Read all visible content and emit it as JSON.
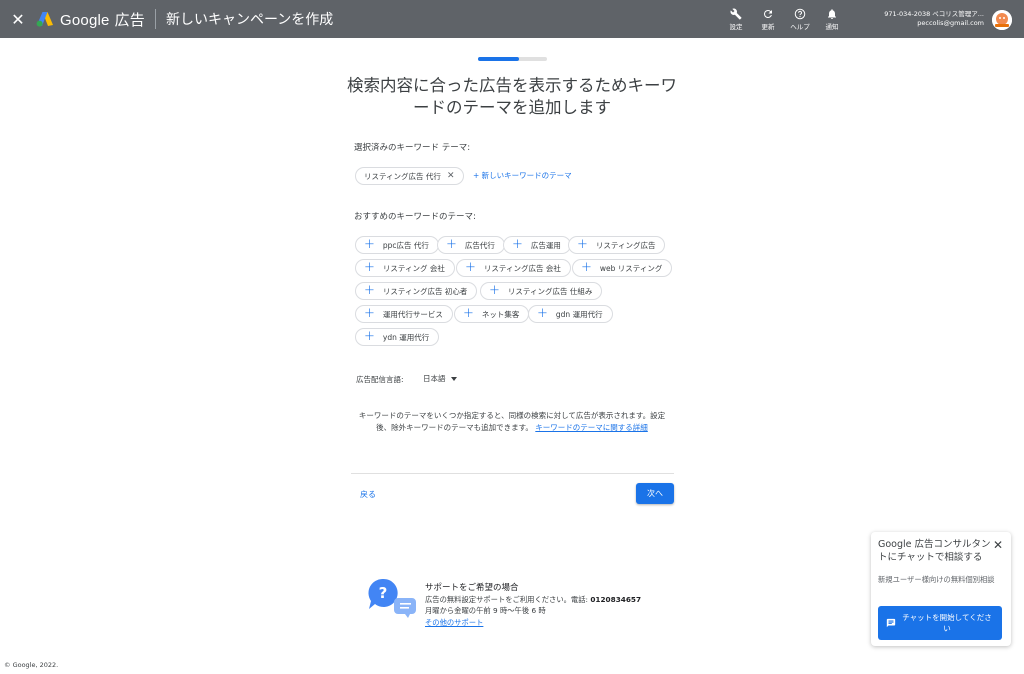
{
  "topbar": {
    "close_icon": "close-icon",
    "brand_google": "Google",
    "brand_ads": "広告",
    "page_title": "新しいキャンペーンを作成",
    "actions": [
      {
        "icon": "wrench-icon",
        "label": "設定"
      },
      {
        "icon": "refresh-icon",
        "label": "更新"
      },
      {
        "icon": "help-icon",
        "label": "ヘルプ"
      },
      {
        "icon": "bell-icon",
        "label": "通知"
      }
    ],
    "account_line1": "971-034-2038 ペコリス管理ア...",
    "account_line2": "peccolis@gmail.com"
  },
  "progress": {
    "value": 0.6
  },
  "main": {
    "headline": "検索内容に合った広告を表示するためキーワードのテーマを追加します",
    "selected_label": "選択済みのキーワード テーマ:",
    "selected_chips": [
      "リスティング広告 代行"
    ],
    "add_theme_link": "+ 新しいキーワードのテーマ",
    "suggested_label": "おすすめのキーワードのテーマ:",
    "suggested_chips": [
      "ppc広告 代行",
      "広告代行",
      "広告運用",
      "リスティング広告",
      "リスティング 会社",
      "リスティング広告 会社",
      "web リスティング",
      "リスティング広告 初心者",
      "リスティング広告 仕組み",
      "運用代行サービス",
      "ネット集客",
      "gdn 運用代行",
      "ydn 運用代行"
    ],
    "language_label": "広告配信言語:",
    "language_value": "日本語",
    "help_text": "キーワードのテーマをいくつか指定すると、同様の検索に対して広告が表示されます。設定後、除外キーワードのテーマも追加できます。",
    "help_link": "キーワードのテーマに関する詳細",
    "back_label": "戻る",
    "next_label": "次へ"
  },
  "support": {
    "title": "サポートをご希望の場合",
    "line1": "広告の無料設定サポートをご利用ください。電話: ",
    "phone": "0120834657",
    "line2": "月曜から金曜の午前 9 時〜午後 6 時",
    "link": "その他のサポート"
  },
  "footer": "© Google, 2022.",
  "chat": {
    "title": "Google 広告コンサルタントにチャットで相談する",
    "subtitle": "新規ユーザー様向けの無料個別相談",
    "button": "チャットを開始してください"
  },
  "colors": {
    "topbar": "#5f6368",
    "accent": "#1a73e8"
  }
}
